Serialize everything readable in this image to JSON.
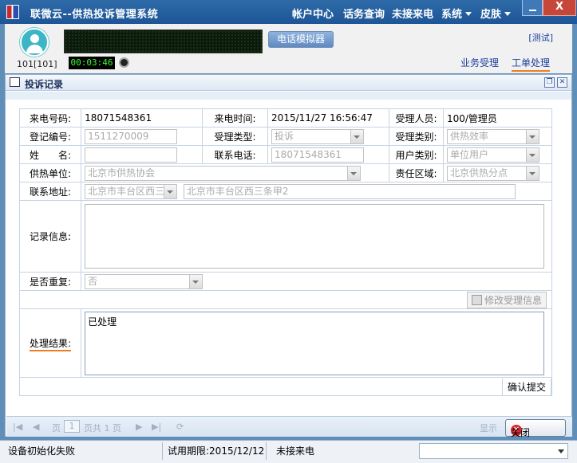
{
  "titlebar": {
    "title": "联微云--供热投诉管理系统",
    "menus": [
      "帐户中心",
      "话务查询",
      "未接来电",
      "系统",
      "皮肤"
    ],
    "close_label": "X"
  },
  "header": {
    "extension": "101[101]",
    "timer": "00:03:46",
    "phone_sim_label": "电话模拟器",
    "test_label": "[测试]",
    "nav": [
      "业务受理",
      "工单处理"
    ]
  },
  "panel": {
    "title": "投诉记录"
  },
  "form": {
    "caller_no_label": "来电号码:",
    "caller_no": "18071548361",
    "call_time_label": "来电时间:",
    "call_time": "2015/11/27 16:56:47",
    "handler_label": "受理人员:",
    "handler": "100/管理员",
    "reg_no_label": "登记编号:",
    "reg_no": "1511270009",
    "accept_type_label": "受理类型:",
    "accept_type": "投诉",
    "accept_category_label": "受理类别:",
    "accept_category": "供热效率",
    "name_label": "姓　　名:",
    "name": "",
    "contact_phone_label": "联系电话:",
    "contact_phone": "18071548361",
    "user_category_label": "用户类别:",
    "user_category": "单位用户",
    "supplier_label": "供热单位:",
    "supplier": "北京市供热协会",
    "region_label": "责任区域:",
    "region": "北京供热分点",
    "address_label": "联系地址:",
    "address_district": "北京市丰台区西三",
    "address_detail": "北京市丰台区西三条甲2",
    "record_label": "记录信息:",
    "record": "",
    "repeat_label": "是否重复:",
    "repeat": "否",
    "modify_label": "修改受理信息",
    "result_label": "处理结果:",
    "result": "已处理",
    "confirm_label": "确认提交"
  },
  "pager": {
    "page_label": "页",
    "page_value": "1",
    "total_label": "页共 1 页",
    "display_label": "显示",
    "close_label": "关闭"
  },
  "status": {
    "device": "设备初始化失败",
    "trial": "试用期限:2015/12/12",
    "missed": "未接来电"
  }
}
